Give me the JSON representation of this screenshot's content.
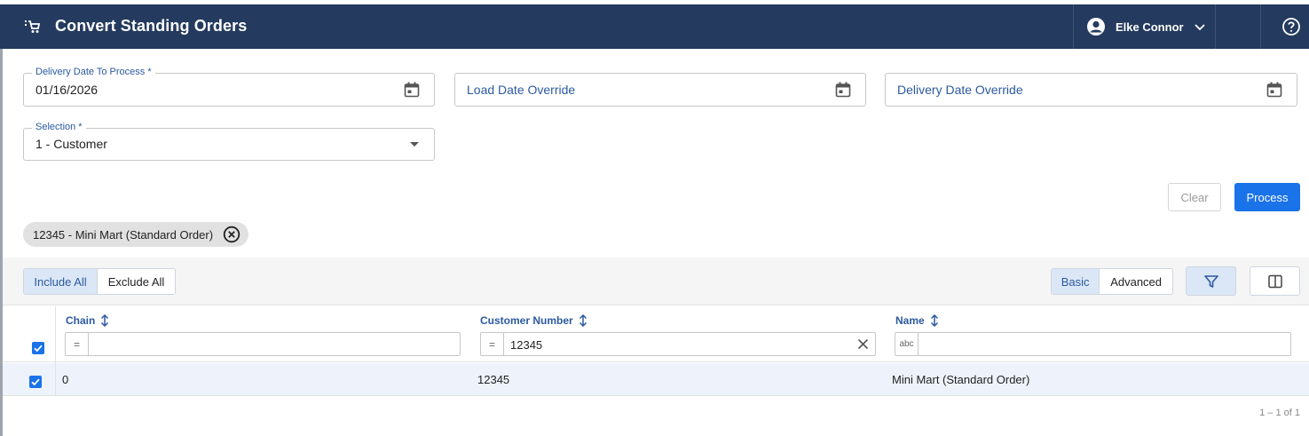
{
  "header": {
    "title": "Convert Standing Orders",
    "user_name": "Elke Connor"
  },
  "form": {
    "delivery_date": {
      "label": "Delivery Date To Process *",
      "value": "01/16/2026"
    },
    "load_date_override": {
      "placeholder": "Load Date Override"
    },
    "delivery_date_override": {
      "placeholder": "Delivery Date Override"
    },
    "selection": {
      "label": "Selection *",
      "value": "1 - Customer"
    }
  },
  "actions": {
    "clear_label": "Clear",
    "process_label": "Process"
  },
  "chips": [
    {
      "label": "12345 - Mini Mart (Standard Order)"
    }
  ],
  "toolbar": {
    "include_all": "Include All",
    "exclude_all": "Exclude All",
    "basic": "Basic",
    "advanced": "Advanced"
  },
  "grid": {
    "columns": [
      {
        "header": "Chain",
        "filter_value": "",
        "filter_op": "="
      },
      {
        "header": "Customer Number",
        "filter_value": "12345",
        "filter_op": "="
      },
      {
        "header": "Name",
        "filter_value": "",
        "filter_op": "abc"
      }
    ],
    "rows": [
      {
        "chain": "0",
        "customer_number": "12345",
        "name": "Mini Mart (Standard Order)",
        "selected": true
      }
    ],
    "pagination": "1 – 1 of 1"
  },
  "colors": {
    "header_bg": "#243a5e",
    "accent": "#1a73e8",
    "label_blue": "#2c5aa0"
  }
}
